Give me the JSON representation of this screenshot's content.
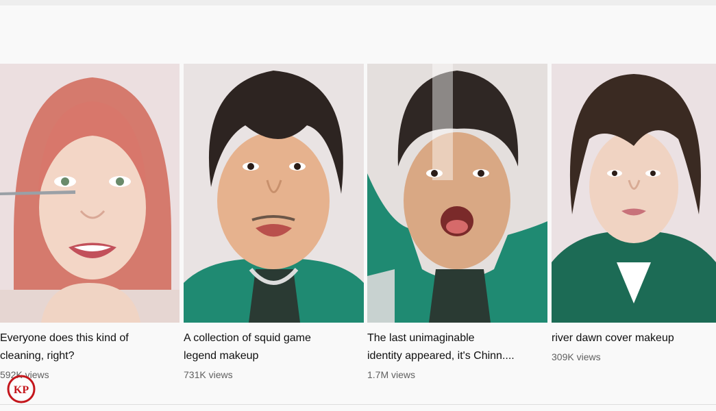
{
  "videos": [
    {
      "title_line1": "Everyone does this kind of",
      "title_line2": "cleaning, right?",
      "views": "592K views",
      "thumbnail_icon": "makeup-portrait-pink-hair"
    },
    {
      "title_line1": "A collection of squid game",
      "title_line2": "legend makeup",
      "views": "731K views",
      "thumbnail_icon": "makeup-portrait-dark-hair"
    },
    {
      "title_line1": "The last unimaginable",
      "title_line2": "identity appeared, it's Chinn....",
      "views": "1.7M views",
      "thumbnail_icon": "makeup-portrait-open-mouth"
    },
    {
      "title_line1": "river dawn cover makeup",
      "title_line2": "",
      "views": "309K views",
      "thumbnail_icon": "makeup-portrait-bob-hair"
    }
  ],
  "watermark": {
    "text": "KP",
    "color": "#c4161c"
  },
  "colors": {
    "track_suit": "#1f8a72",
    "background": "#f9f9f9",
    "title_text": "#0f0f0f",
    "meta_text": "#606060"
  }
}
